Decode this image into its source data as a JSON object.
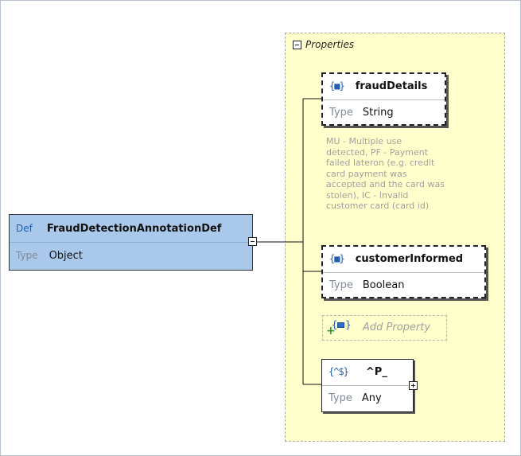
{
  "panel": {
    "title": "Properties"
  },
  "definition": {
    "keyword": "Def",
    "name": "FraudDetectionAnnotationDef",
    "type_label": "Type",
    "type_value": "Object"
  },
  "properties": [
    {
      "icon": "{■}",
      "name": "fraudDetails",
      "type_label": "Type",
      "type_value": "String",
      "description": "MU -  Multiple use\ndetected, PF -  Payment\nfailed lateron (e.g. credit\ncard payment was\naccepted and the card was\nstolen), IC -  Invalid\ncustomer card (card id)"
    },
    {
      "icon": "{■}",
      "name": "customerInformed",
      "type_label": "Type",
      "type_value": "Boolean"
    }
  ],
  "add_property": {
    "label": "Add Property"
  },
  "pattern_property": {
    "icon": "{^$}",
    "name": "^P_",
    "type_label": "Type",
    "type_value": "Any"
  },
  "colors": {
    "definition_fill": "#a9c8ea",
    "panel_fill": "#ffffcc",
    "keyword_blue": "#1f5fae"
  }
}
